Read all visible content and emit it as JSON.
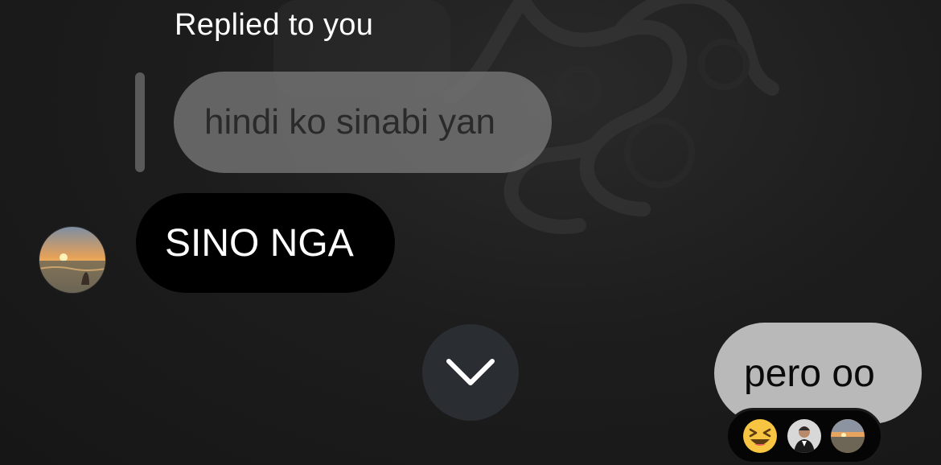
{
  "thread": {
    "reply_caption": "Replied to you",
    "quoted_message": "hindi ko sinabi yan",
    "received_message": "SINO NGA",
    "sent_message": "pero oo"
  },
  "reactions": {
    "items": [
      {
        "icon": "laughing-squinting-emoji-icon"
      },
      {
        "icon": "reactor-avatar-man"
      },
      {
        "icon": "reactor-avatar-sunset"
      }
    ]
  },
  "colors": {
    "received_bubble": "#000000",
    "sent_bubble": "#b9b9b9",
    "quoted_bubble": "#787878",
    "background": "#1c1c1c"
  },
  "icons": {
    "scroll_down": "chevron-down-icon",
    "sender_avatar": "sunset-beach-avatar"
  }
}
